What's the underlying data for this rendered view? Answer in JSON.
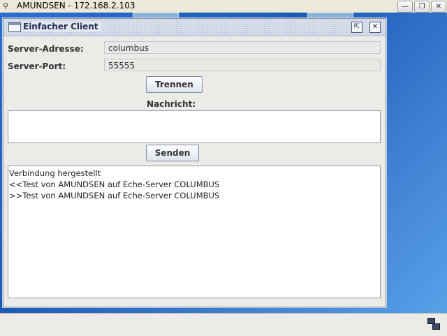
{
  "outer_window": {
    "title": "AMUNDSEN - 172.168.2.103",
    "minimize_glyph": "—",
    "restore_glyph": "❐",
    "close_glyph": "✕"
  },
  "app": {
    "title": "Einfacher Client",
    "maximize_glyph": "⇱",
    "close_glyph": "✕",
    "server_address_label": "Server-Adresse:",
    "server_address_value": "columbus",
    "server_port_label": "Server-Port:",
    "server_port_value": "55555",
    "disconnect_button": "Trennen",
    "message_label": "Nachricht:",
    "message_value": "",
    "send_button": "Senden",
    "log_lines": [
      "Verbindung hergestellt",
      "<<Test von AMUNDSEN auf Eche-Server COLUMBUS",
      ">>Test von AMUNDSEN auf Eche-Server COLUMBUS"
    ]
  },
  "icons": [
    "remote-desktop-icon",
    "window-icon",
    "maximize-icon",
    "close-icon",
    "tray-icon"
  ],
  "colors": {
    "desktop": "#1f5fb8",
    "window_bg": "#ecebe7",
    "button_border": "#7a8ca8"
  }
}
